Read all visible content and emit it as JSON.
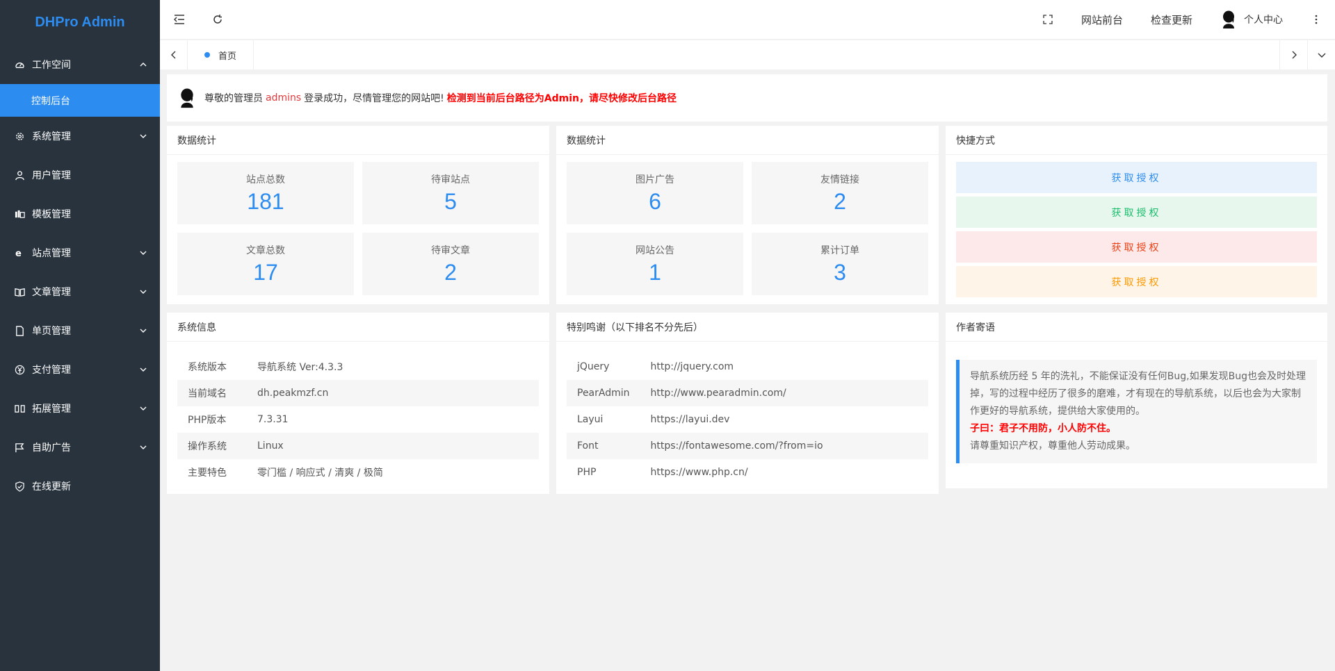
{
  "app": {
    "title": "DHPro Admin"
  },
  "sidebar": {
    "items": [
      {
        "label": "工作空间",
        "icon": "dashboard-icon",
        "expanded": true,
        "children": [
          {
            "label": "控制后台",
            "active": true
          }
        ]
      },
      {
        "label": "系统管理",
        "icon": "gear-icon",
        "expanded": false
      },
      {
        "label": "用户管理",
        "icon": "user-icon"
      },
      {
        "label": "模板管理",
        "icon": "template-icon"
      },
      {
        "label": "站点管理",
        "icon": "ie-icon",
        "expanded": false
      },
      {
        "label": "文章管理",
        "icon": "book-icon",
        "expanded": false
      },
      {
        "label": "单页管理",
        "icon": "file-icon",
        "expanded": false
      },
      {
        "label": "支付管理",
        "icon": "yen-icon",
        "expanded": false
      },
      {
        "label": "拓展管理",
        "icon": "columns-icon",
        "expanded": false
      },
      {
        "label": "自助广告",
        "icon": "flag-icon",
        "expanded": false
      },
      {
        "label": "在线更新",
        "icon": "shield-check-icon"
      }
    ]
  },
  "header": {
    "links": [
      "网站前台",
      "检查更新"
    ],
    "user_label": "个人中心"
  },
  "tabs": {
    "items": [
      {
        "label": "首页",
        "active": true
      }
    ]
  },
  "welcome": {
    "prefix": "尊敬的管理员",
    "username": "admins",
    "message": "登录成功，尽情管理您的网站吧!",
    "warning": "检测到当前后台路径为Admin，请尽快修改后台路径"
  },
  "stats_left": {
    "title": "数据统计",
    "items": [
      {
        "label": "站点总数",
        "value": "181"
      },
      {
        "label": "待审站点",
        "value": "5"
      },
      {
        "label": "文章总数",
        "value": "17"
      },
      {
        "label": "待审文章",
        "value": "2"
      }
    ]
  },
  "stats_mid": {
    "title": "数据统计",
    "items": [
      {
        "label": "图片广告",
        "value": "6"
      },
      {
        "label": "友情链接",
        "value": "2"
      },
      {
        "label": "网站公告",
        "value": "1"
      },
      {
        "label": "累计订单",
        "value": "3"
      }
    ]
  },
  "quick": {
    "title": "快捷方式",
    "buttons": [
      {
        "label": "获取授权",
        "color": "#2d8cf0",
        "bg": "#e8f2fd"
      },
      {
        "label": "获取授权",
        "color": "#19be6b",
        "bg": "#e8f7ee"
      },
      {
        "label": "获取授权",
        "color": "#ed4014",
        "bg": "#fde9e9"
      },
      {
        "label": "获取授权",
        "color": "#ff9900",
        "bg": "#fef4e8"
      }
    ]
  },
  "sysinfo": {
    "title": "系统信息",
    "rows": [
      {
        "k": "系统版本",
        "v": "导航系统 Ver:4.3.3"
      },
      {
        "k": "当前域名",
        "v": "dh.peakmzf.cn"
      },
      {
        "k": "PHP版本",
        "v": "7.3.31"
      },
      {
        "k": "操作系统",
        "v": "Linux"
      },
      {
        "k": "主要特色",
        "v": "零门槛 / 响应式 / 清爽 / 极简"
      }
    ]
  },
  "thanks": {
    "title": "特别鸣谢（以下排名不分先后）",
    "rows": [
      {
        "k": "jQuery",
        "v": "http://jquery.com"
      },
      {
        "k": "PearAdmin",
        "v": "http://www.pearadmin.com/"
      },
      {
        "k": "Layui",
        "v": "https://layui.dev"
      },
      {
        "k": "Font",
        "v": "https://fontawesome.com/?from=io"
      },
      {
        "k": "PHP",
        "v": "https://www.php.cn/"
      }
    ]
  },
  "author": {
    "title": "作者寄语",
    "text1": "导航系统历经 5 年的洗礼，不能保证没有任何Bug,如果发现Bug也会及时处理掉，写的过程中经历了很多的磨难，才有现在的导航系统，以后也会为大家制作更好的导航系统，提供给大家使用的。",
    "text2": "子曰：君子不用防，小人防不住。",
    "text3": "请尊重知识产权，尊重他人劳动成果。"
  },
  "colors": {
    "accent": "#2d8cf0",
    "sidebar_bg": "#28333e",
    "warning": "#ff0000"
  }
}
